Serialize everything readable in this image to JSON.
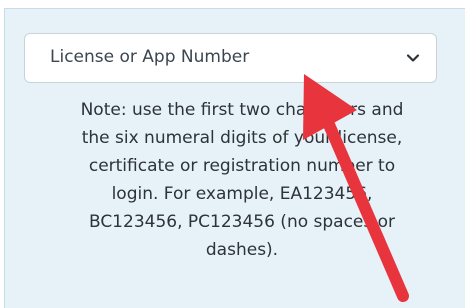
{
  "login": {
    "select_value": "License or App Number",
    "note_lines": [
      "Note: use the first two characters and",
      "the six numeral digits of your license,",
      "certificate or registration number to",
      "login. For example, EA123456,",
      "BC123456, PC123456 (no spaces or",
      "dashes)."
    ]
  },
  "icons": {
    "dropdown": "chevron-down-icon",
    "pointer": "red-arrow-icon"
  },
  "colors": {
    "panel_background": "#e6f1f8",
    "select_background": "#ffffff",
    "text": "#2d3338",
    "arrow": "#e8343d"
  }
}
